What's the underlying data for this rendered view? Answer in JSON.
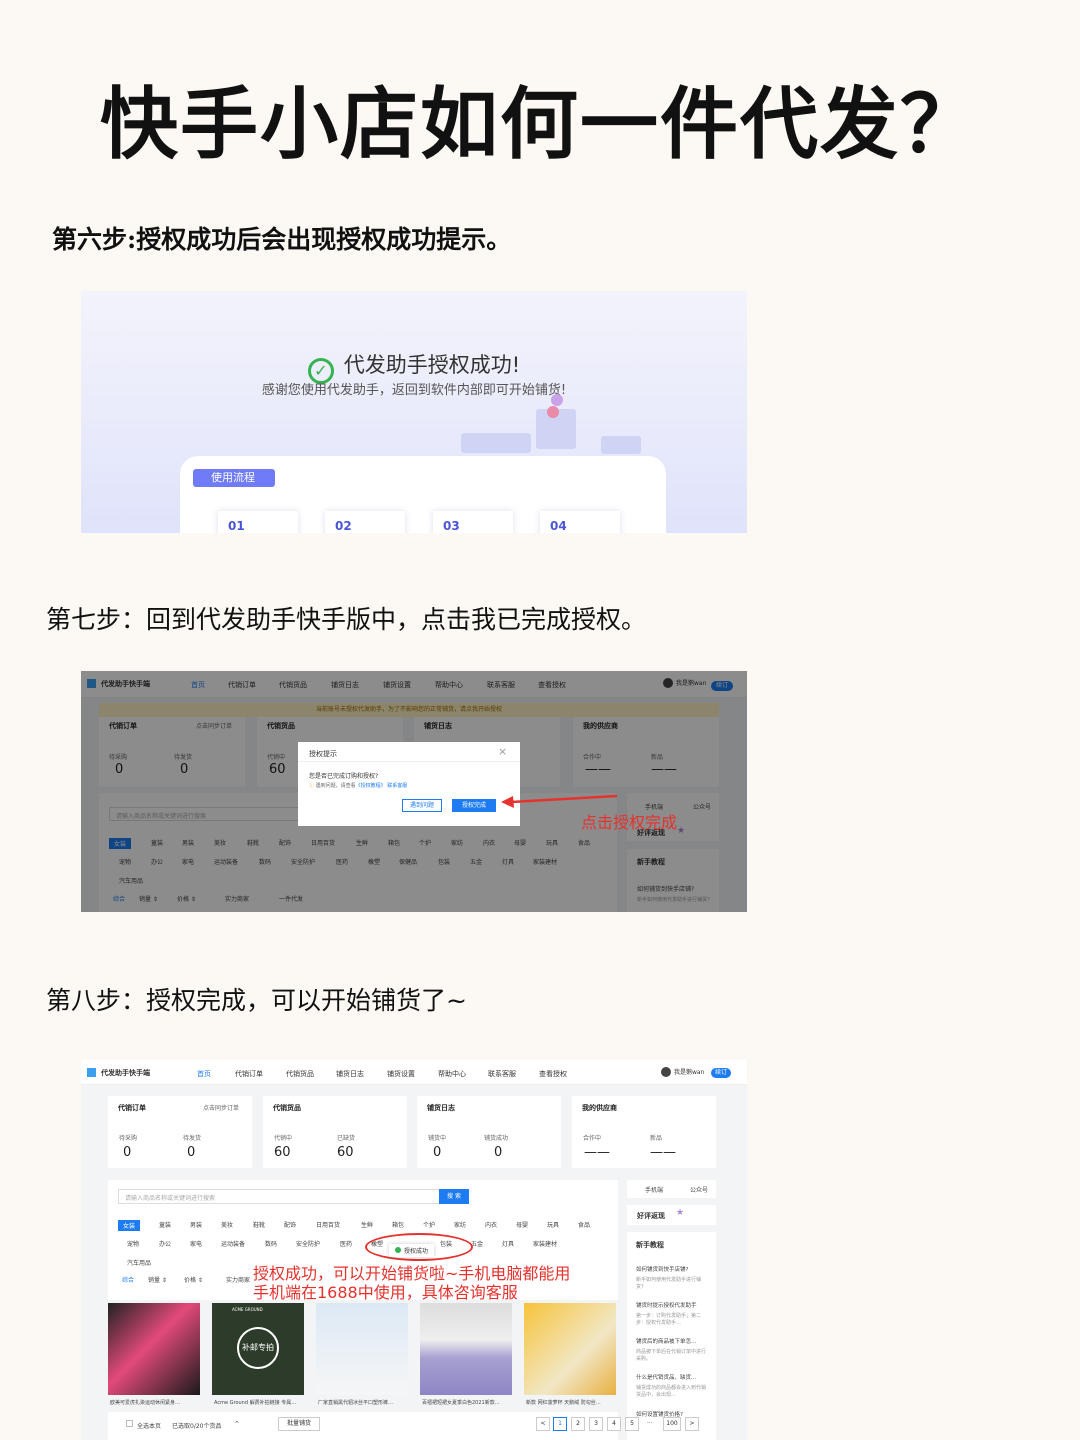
{
  "title": "快手小店如何一件代发？",
  "step6": "第六步:授权成功后会出现授权成功提示。",
  "step7": "第七步：回到代发助手快手版中，点击我已完成授权。",
  "step8": "第八步：授权完成，可以开始铺货了~",
  "shot1": {
    "success_title": "代发助手授权成功!",
    "success_sub": "感谢您使用代发助手，返回到软件内部即可开始铺货!",
    "flow_label": "使用流程",
    "steps": [
      "01",
      "02",
      "03",
      "04"
    ]
  },
  "app": {
    "app_name": "代发助手快手端",
    "nav": [
      "首页",
      "代销订单",
      "代销货品",
      "铺货日志",
      "铺货设置",
      "帮助中心",
      "联系客服",
      "查看授权"
    ],
    "user": "我是鹅wan",
    "user_btn": "续订",
    "banner": "当前账号未授权代发助手，为了不影响您的正常铺货，请点我开始授权",
    "panels": {
      "orders": {
        "title": "代销订单",
        "link": "点击同步订单",
        "l1": "待采购",
        "l2": "待发货",
        "v1": "0",
        "v2": "0"
      },
      "goods": {
        "title": "代销货品",
        "l1": "代销中",
        "l2": "已缺货",
        "v1": "60",
        "v2": "60"
      },
      "logs": {
        "title": "铺货日志",
        "l1": "铺货中",
        "l2": "铺货成功",
        "v1": "0",
        "v2": "0"
      },
      "suppliers": {
        "title": "我的供应商",
        "l1": "合作中",
        "l2": "新品",
        "v1": "——",
        "v2": "——"
      }
    },
    "search_placeholder": "请输入商品名称或关键词进行搜索",
    "search_btn": "搜 索",
    "cats_row1": [
      "女装",
      "童装",
      "男装",
      "美妆",
      "鞋靴",
      "配饰",
      "日用百货",
      "生鲜",
      "箱包",
      "个护",
      "家纺",
      "内衣",
      "母婴",
      "玩具",
      "食品"
    ],
    "cats_row2": [
      "宠物",
      "办公",
      "家电",
      "运动装备",
      "数码",
      "安全防护",
      "医药",
      "橡塑",
      "保健品",
      "包装",
      "五金",
      "灯具",
      "家装建材"
    ],
    "cats_row3": [
      "汽车用品"
    ],
    "sort": [
      "综合",
      "销量 ⇕",
      "价格 ⇕",
      "实力商家",
      "一件代发"
    ],
    "right": {
      "tab1": "手机端",
      "tab2": "公众号",
      "praise": "好评返现",
      "tutorial": "新手教程",
      "q1": "如何铺货到快手店铺?",
      "q1d": "新手如何使用代发助手进行铺货?",
      "q2": "铺货时提示授权代发助手",
      "q2d": "第一步：订购代发助手；第二步：授权代发助手…",
      "q3": "铺货后的商品被下单怎…",
      "q3d": "商品被下单后在代销订单中进行采购。",
      "q4": "什么是代销货品、缺货…",
      "q4d": "铺货成功的商品都会进入到代销货品中，会出现…",
      "q5": "如何设置铺货价格?"
    },
    "dialog": {
      "title": "授权提示",
      "close": "×",
      "q": "您是否已完成订购和授权?",
      "help_prefix": "遇到问题，请查看",
      "help_link": "《授权教程》",
      "help_link2": "联系客服",
      "btn1": "遇到问题",
      "btn2": "授权完成"
    },
    "annot7": "点击授权完成",
    "toast": "授权成功",
    "annot8_line1": "授权成功，可以开始铺货啦~手机电脑都能用",
    "annot8_line2": "手机端在1688中使用，具体咨询客服",
    "products": [
      "欧美可爱虎扎染运动休闲紧身…",
      "Acme Ground 解费补拍链接 专属…",
      "厂家直销黑代貂冰丝平口塑形裤…",
      "百褶裙短裙女夏季白色2021新款…",
      "新款 网红菠萝杯 天鹅绒 防勾丝…"
    ],
    "product_stamp": "补邮专拍",
    "product_brand": "ACME GROUND",
    "footer": {
      "select_all": "全选本页",
      "selected": "已选取0/20个货品",
      "batch": "批量铺货"
    },
    "pages": [
      "<",
      "1",
      "2",
      "3",
      "4",
      "5",
      "···",
      "100",
      ">"
    ]
  }
}
